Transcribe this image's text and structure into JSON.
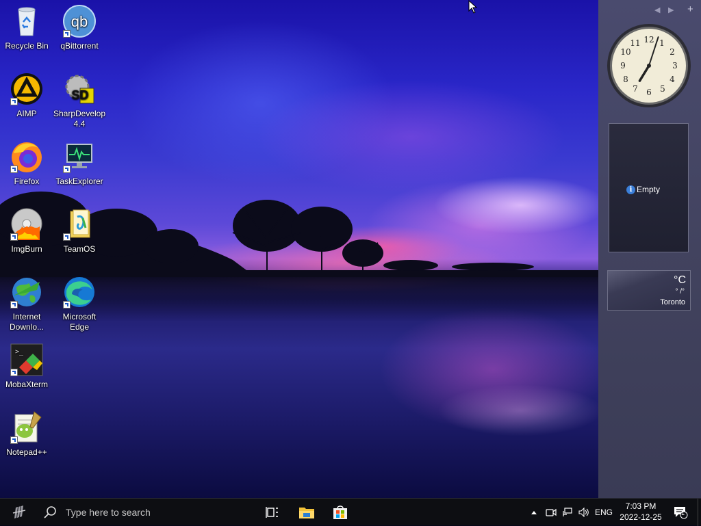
{
  "desktop_icons": [
    {
      "id": "recycle-bin",
      "label": "Recycle Bin",
      "shortcut": false
    },
    {
      "id": "qbittorrent",
      "label": "qBittorrent",
      "shortcut": true
    },
    {
      "id": "aimp",
      "label": "AIMP",
      "shortcut": true
    },
    {
      "id": "sharpdevelop",
      "label": "SharpDevelop 4.4",
      "shortcut": false
    },
    {
      "id": "firefox",
      "label": "Firefox",
      "shortcut": true
    },
    {
      "id": "taskexplorer",
      "label": "TaskExplorer",
      "shortcut": true
    },
    {
      "id": "imgburn",
      "label": "ImgBurn",
      "shortcut": true
    },
    {
      "id": "teamos",
      "label": "TeamOS",
      "shortcut": true
    },
    {
      "id": "internet-download",
      "label": "Internet Downlo...",
      "shortcut": true
    },
    {
      "id": "microsoft-edge",
      "label": "Microsoft Edge",
      "shortcut": true
    },
    {
      "id": "mobaxterm",
      "label": "MobaXterm",
      "shortcut": true
    },
    {
      "id": "notepadpp",
      "label": "Notepad++",
      "shortcut": true
    }
  ],
  "sidebar": {
    "controls": {
      "prev": "◀",
      "next": "▶",
      "add": "+"
    },
    "clock": {
      "hour": 7,
      "minute": 3
    },
    "notes_gadget": {
      "message": "Empty",
      "info_icon": "i"
    },
    "weather_gadget": {
      "unit": "°C",
      "range": "° /°",
      "city": "Toronto"
    }
  },
  "taskbar": {
    "search_placeholder": "Type here to search",
    "language": "ENG",
    "time": "7:03 PM",
    "date": "2022-12-25",
    "notification_count": "1",
    "icons": [
      "start-icon",
      "search-icon",
      "task-view-icon",
      "file-explorer-icon",
      "microsoft-store-icon",
      "chevron-up-icon",
      "meet-now-icon",
      "network-icon",
      "volume-icon",
      "action-center-icon"
    ]
  },
  "colors": {
    "taskbar_bg": "#0d0e12",
    "sidebar_bg": "#42435f",
    "accent": "#3b7fd9"
  }
}
